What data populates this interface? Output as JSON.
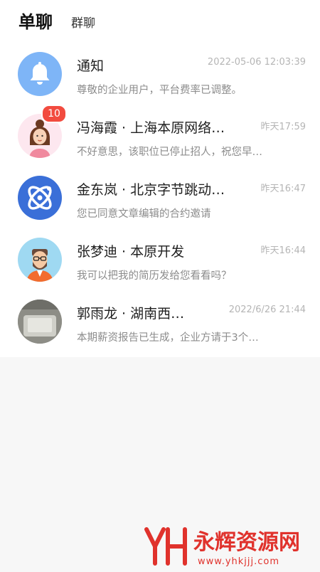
{
  "tabs": {
    "active": "单聊",
    "other": "群聊"
  },
  "chats": [
    {
      "name": "通知",
      "time": "2022-05-06 12:03:39",
      "preview": "尊敬的企业用户，平台费率已调整。",
      "avatar": "bell-icon",
      "badge": null
    },
    {
      "name": "冯海霞 · 上海本原网络…",
      "time": "昨天17:59",
      "preview": "不好意思，该职位已停止招人，祝您早…",
      "avatar": "woman-avatar",
      "badge": "10"
    },
    {
      "name": "金东岚 · 北京字节跳动…",
      "time": "昨天16:47",
      "preview": "您已同意文章编辑的合约邀请",
      "avatar": "bytedance-logo",
      "badge": null
    },
    {
      "name": "张梦迪 · 本原开发",
      "time": "昨天16:44",
      "preview": "我可以把我的简历发给您看看吗？",
      "avatar": "man-glasses-avatar",
      "badge": null
    },
    {
      "name": "郭雨龙 · 湖南西…",
      "time": "2022/6/26 21:44",
      "preview": "本期薪资报告已生成，企业方请于3个…",
      "avatar": "photo-avatar",
      "badge": null
    }
  ],
  "watermark": {
    "brand": "永辉资源网",
    "url": "www.yhkjjj.com"
  },
  "colors": {
    "bell_bg": "#7eb5f7",
    "badge": "#f24b3f",
    "logo_blue": "#3a6fd8",
    "watermark_red": "#e0322c"
  }
}
